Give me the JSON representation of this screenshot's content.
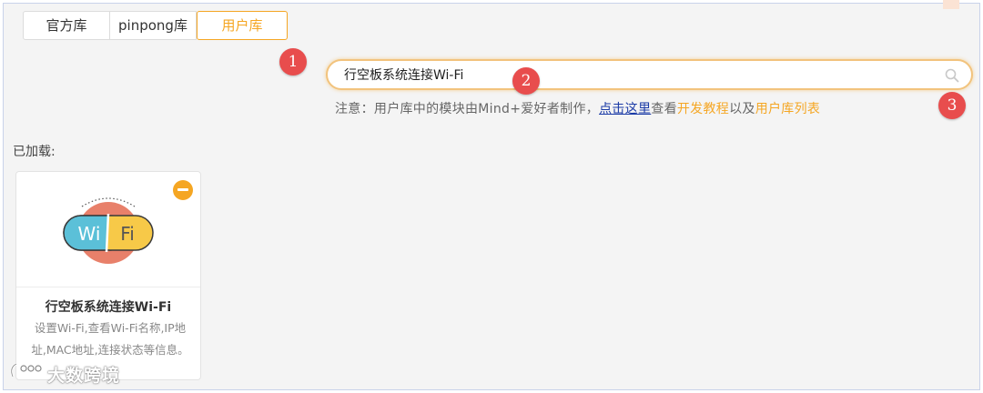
{
  "tabs": [
    {
      "label": "官方库",
      "active": false
    },
    {
      "label": "pinpong库",
      "active": false
    },
    {
      "label": "用户库",
      "active": true
    }
  ],
  "markers": [
    "1",
    "2",
    "3"
  ],
  "search": {
    "value": "行空板系统连接Wi-Fi",
    "icon": "search-icon"
  },
  "note": {
    "prefix": "注意：用户库中的模块由Mind+爱好者制作，",
    "link": "点击这里",
    "middle1": "查看",
    "tutorial": "开发教程",
    "middle2": "以及",
    "list": "用户库列表"
  },
  "loaded": {
    "label": "已加载:",
    "card": {
      "image_text_left": "Wi",
      "image_text_right": "Fi",
      "title": "行空板系统连接Wi-Fi",
      "description": "设置Wi-Fi,查看Wi-Fi名称,IP地址,MAC地址,连接状态等信息。"
    }
  },
  "watermark": "大数跨境",
  "colors": {
    "accent": "#f5a623",
    "marker": "#e84d4d",
    "link": "#1a3aa6",
    "wifi_blue": "#5bc0d8",
    "wifi_yellow": "#f7c948",
    "wifi_red": "#e8806a"
  }
}
